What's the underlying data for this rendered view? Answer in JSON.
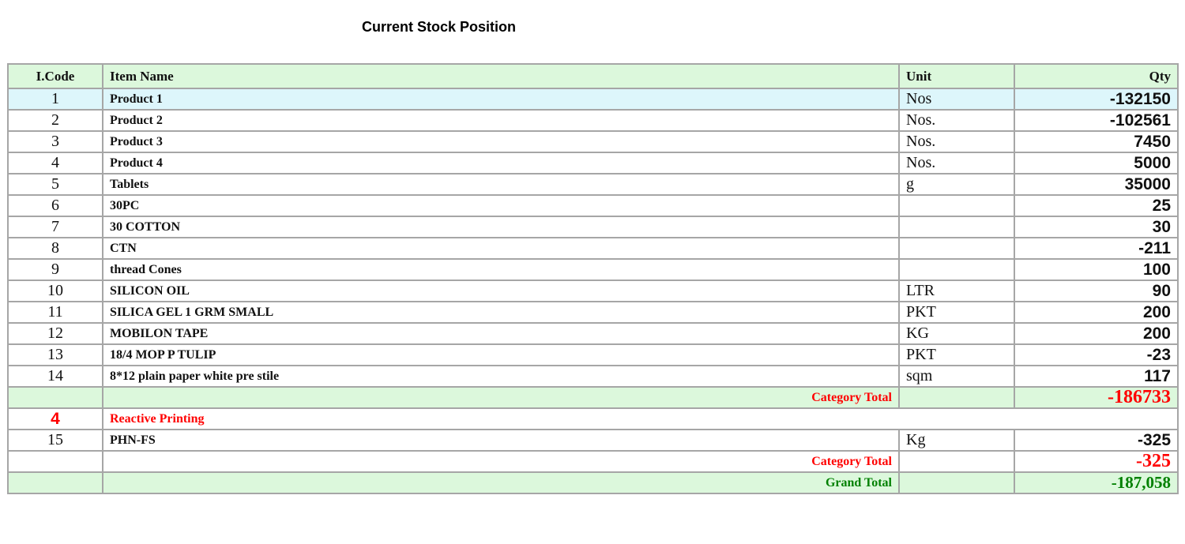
{
  "title": "Current Stock Position",
  "table": {
    "headers": {
      "code": "I.Code",
      "name": "Item Name",
      "unit": "Unit",
      "qty": "Qty"
    },
    "rows": [
      {
        "code": "1",
        "name": "Product 1",
        "unit": "Nos",
        "qty": "-132150"
      },
      {
        "code": "2",
        "name": "Product 2",
        "unit": "Nos.",
        "qty": "-102561"
      },
      {
        "code": "3",
        "name": "Product 3",
        "unit": "Nos.",
        "qty": "7450"
      },
      {
        "code": "4",
        "name": "Product 4",
        "unit": "Nos.",
        "qty": "5000"
      },
      {
        "code": "5",
        "name": "Tablets",
        "unit": "g",
        "qty": "35000"
      },
      {
        "code": "6",
        "name": "30PC",
        "unit": "",
        "qty": "25"
      },
      {
        "code": "7",
        "name": "30 COTTON",
        "unit": "",
        "qty": "30"
      },
      {
        "code": "8",
        "name": "CTN",
        "unit": "",
        "qty": "-211"
      },
      {
        "code": "9",
        "name": "thread Cones",
        "unit": "",
        "qty": "100"
      },
      {
        "code": "10",
        "name": "SILICON OIL",
        "unit": "LTR",
        "qty": "90"
      },
      {
        "code": "11",
        "name": "SILICA GEL 1 GRM SMALL",
        "unit": "PKT",
        "qty": "200"
      },
      {
        "code": "12",
        "name": "MOBILON TAPE",
        "unit": "KG",
        "qty": "200"
      },
      {
        "code": "13",
        "name": "18/4 MOP P TULIP",
        "unit": "PKT",
        "qty": "-23"
      },
      {
        "code": "14",
        "name": "8*12 plain paper white pre stile",
        "unit": "sqm",
        "qty": "117"
      }
    ],
    "category_total_1": {
      "label": "Category Total",
      "value": "-186733"
    },
    "category_2": {
      "code": "4",
      "name": "Reactive Printing",
      "rows": [
        {
          "code": "15",
          "name": "PHN-FS",
          "unit": "Kg",
          "qty": "-325"
        }
      ],
      "total": {
        "label": "Category Total",
        "value": "-325"
      }
    },
    "grand_total": {
      "label": "Grand Total",
      "value": "-187,058"
    }
  },
  "colors": {
    "header_bg": "#dcf8dc",
    "highlight_row_bg": "#ddf6fb",
    "total_red": "#ff0000",
    "grand_total_green": "#008000",
    "border": "#a6a6a6"
  }
}
